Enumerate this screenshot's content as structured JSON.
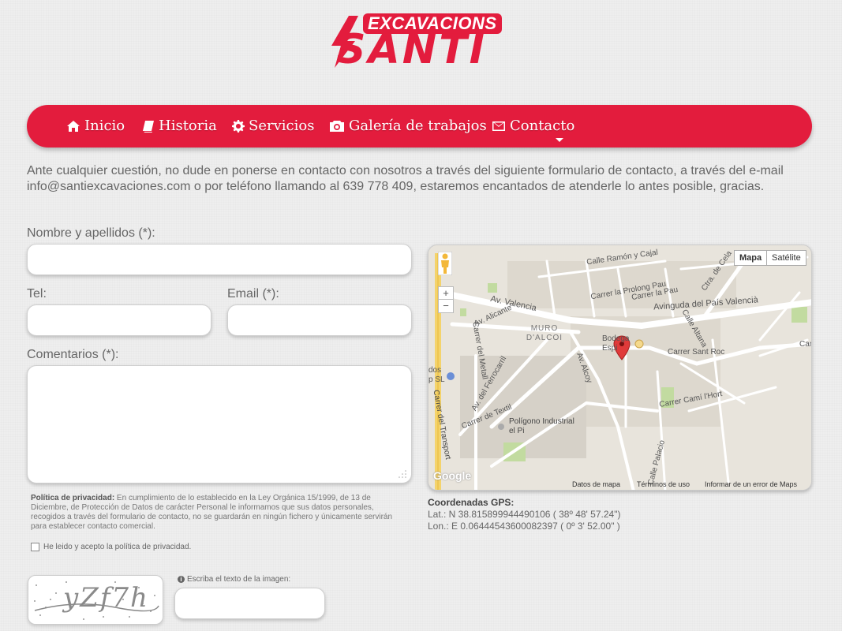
{
  "logo": {
    "top": "EXCAVACIONS",
    "main": "SANTI"
  },
  "nav": {
    "items": [
      {
        "label": "Inicio",
        "icon": "home-icon"
      },
      {
        "label": "Historia",
        "icon": "book-icon"
      },
      {
        "label": "Servicios",
        "icon": "gear-icon"
      },
      {
        "label": "Galería de trabajos",
        "icon": "camera-icon"
      },
      {
        "label": "Contacto",
        "icon": "envelope-icon"
      }
    ],
    "active": "Contacto",
    "color": "#e31c3d"
  },
  "intro": "Ante cualquier cuestión, no dude en ponerse en contacto con nosotros a través del siguiente formulario de contacto, a través del e-mail info@santiexcavaciones.com o por teléfono llamando al 639 778 409, estaremos encantados de atenderle lo antes posible, gracias.",
  "form": {
    "name_label": "Nombre y apellidos (*):",
    "tel_label": "Tel:",
    "email_label": "Email (*):",
    "comments_label": "Comentarios (*):",
    "privacy_title": "Política de privacidad:",
    "privacy_text": " En cumplimiento de lo establecido en la Ley Orgánica 15/1999, de 13 de Diciembre, de Protección de Datos de carácter Personal le informamos que sus datos personales, recogidos a través del formulario de contacto, no se guardarán en ningún fichero y únicamente servirán para establecer contacto comercial.",
    "accept_label": "He leido y acepto la política de privacidad.",
    "captcha_text": "yZf7h",
    "captcha_hint": "Escriba el texto de la imagen:"
  },
  "map": {
    "type_map": "Mapa",
    "type_satellite": "Satélite",
    "zoom_in": "+",
    "zoom_out": "−",
    "labels": {
      "ramon": "Calle Ramón y Cajal",
      "prolong": "Carrer la Prolong Pau",
      "pau": "Carrer la Pau",
      "cela": "Ctra. de Cela",
      "valencia": "Av. Valencia",
      "pais": "Avinguda del País Valencià",
      "alicante": "Av. Alicante",
      "metall": "Carrer del Metall",
      "muro": "MURO D'ALCOI",
      "bodega": "Bodega Espi",
      "altana": "Calle Altana",
      "santroc": "Carrer Sant Roc",
      "ferrocarril": "Av. del Ferrocarril",
      "alcoy": "Av. Alcoy",
      "textil": "Carrer de Textil",
      "poligono": "Polígono Industrial el Pi",
      "transport": "Carrer del Transport",
      "camihort": "Carrer Camí l'Hort",
      "palacio": "Calle Palacio",
      "dos": "dos",
      "psl": "p SL",
      "cari": "Cari"
    },
    "google": "Google",
    "footer": {
      "datos": "Datos de mapa",
      "terminos": "Términos de uso",
      "error": "Informar de un error de Maps"
    }
  },
  "gps": {
    "title": "Coordenadas GPS:",
    "lat": "Lat.: N 38.815899944490106 ( 38º 48' 57.24\")",
    "lon": "Lon.: E 0.06444543600082397 ( 0º 3' 52.00\" )"
  }
}
